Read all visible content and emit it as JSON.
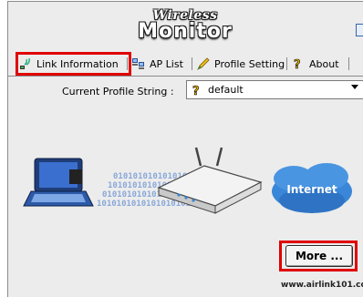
{
  "logo": {
    "line1": "Wireless",
    "line2": "Monitor"
  },
  "tabs": [
    {
      "label": "Link Information",
      "icon": "antenna-icon",
      "active": true
    },
    {
      "label": "AP List",
      "icon": "computers-icon"
    },
    {
      "label": "Profile Setting",
      "icon": "pencil-icon"
    },
    {
      "label": "About",
      "icon": "question-key-icon"
    }
  ],
  "profile": {
    "label": "Current Profile String :",
    "value": "default"
  },
  "diagram": {
    "binary_rows": [
      "0101010101010101010",
      "1010101010101010101",
      "0101010101010101010",
      "1010101010101010101"
    ],
    "cloud_label": "Internet"
  },
  "more_button": {
    "label": "More ..."
  },
  "footer": {
    "url": "www.airlink101.com"
  },
  "colors": {
    "highlight": "#e00000",
    "cloud": "#3a86d8",
    "panel": "#ececec"
  }
}
